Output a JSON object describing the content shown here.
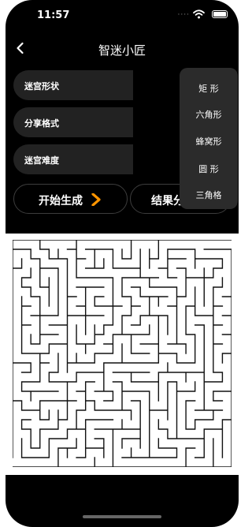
{
  "status_bar": {
    "time": "11:57",
    "signal": "····"
  },
  "nav": {
    "title": "智迷小匠"
  },
  "rows": [
    {
      "label": "迷宫形状",
      "value": ""
    },
    {
      "label": "分享格式",
      "value": ""
    },
    {
      "label": "迷宫难度",
      "value": ""
    }
  ],
  "actions": {
    "start_label": "开始生成",
    "share_label": "结果分"
  },
  "dropdown": {
    "options": [
      "矩 形",
      "六角形",
      "蜂窝形",
      "圆 形",
      "三角格"
    ]
  },
  "maze": {
    "columns": 24,
    "rows": 24,
    "wall_color": "#111111"
  },
  "colors": {
    "background": "#000000",
    "row": "#222222",
    "accent": "#ff9500"
  }
}
